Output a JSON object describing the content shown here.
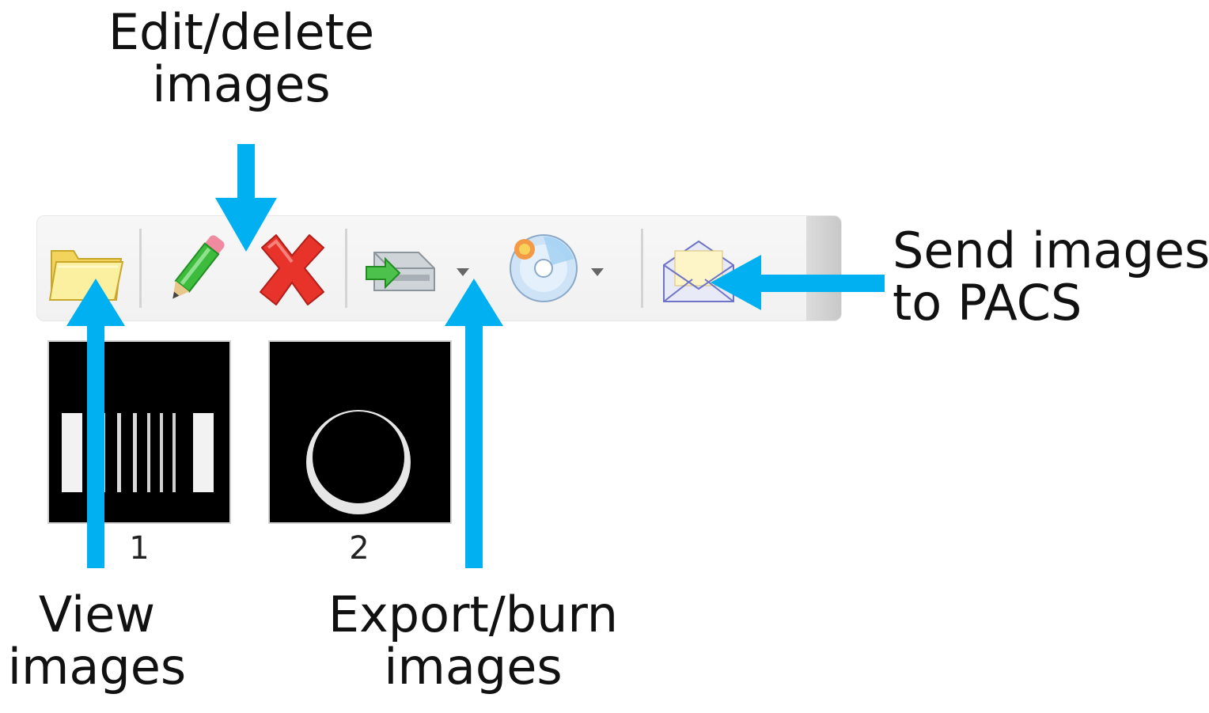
{
  "callouts": {
    "edit_delete": [
      "Edit/delete",
      "images"
    ],
    "send": [
      "Send images",
      "to PACS"
    ],
    "view": [
      "View",
      "images"
    ],
    "export_burn": [
      "Export/burn",
      "images"
    ]
  },
  "toolbar": {
    "buttons": [
      {
        "name": "open-folder",
        "icon": "folder-icon"
      },
      {
        "name": "edit",
        "icon": "pencil-icon"
      },
      {
        "name": "delete",
        "icon": "red-x-icon"
      },
      {
        "name": "export",
        "icon": "drive-export-icon",
        "has_dropdown": true
      },
      {
        "name": "burn",
        "icon": "cd-burn-icon",
        "has_dropdown": true
      },
      {
        "name": "send",
        "icon": "envelope-icon"
      }
    ]
  },
  "thumbnails": [
    {
      "label": "1",
      "content": "line-pair-phantom"
    },
    {
      "label": "2",
      "content": "ring-phantom"
    }
  ],
  "colors": {
    "arrow": "#00b0f0",
    "callout_text": "#111111",
    "toolbar_bg": "#f4f4f4",
    "delete_red": "#e8332a",
    "pencil_green": "#3dbb3d",
    "folder_yellow": "#f6e27a"
  }
}
